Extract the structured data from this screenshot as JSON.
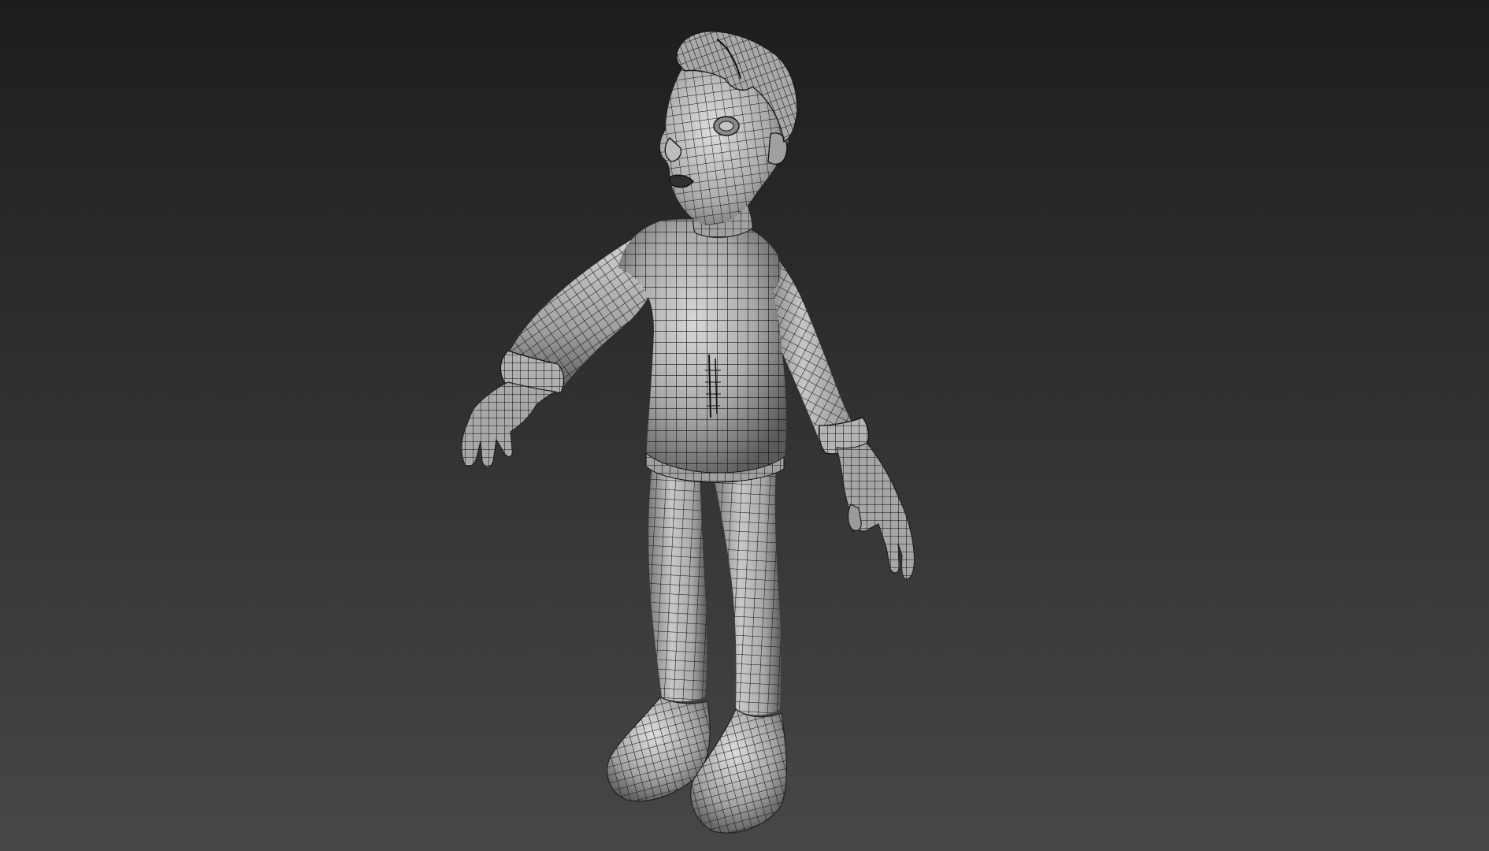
{
  "viewport": {
    "background_top": "#1d1d1d",
    "background_bottom": "#474747"
  },
  "model": {
    "subject": "character-mesh",
    "shading": "smooth-shaded-with-wireframe-overlay",
    "surface_color": "#9c9c9c",
    "highlight_color": "#d6d6d6",
    "shadow_color": "#4a4a4a",
    "wire_color": "#111111"
  }
}
